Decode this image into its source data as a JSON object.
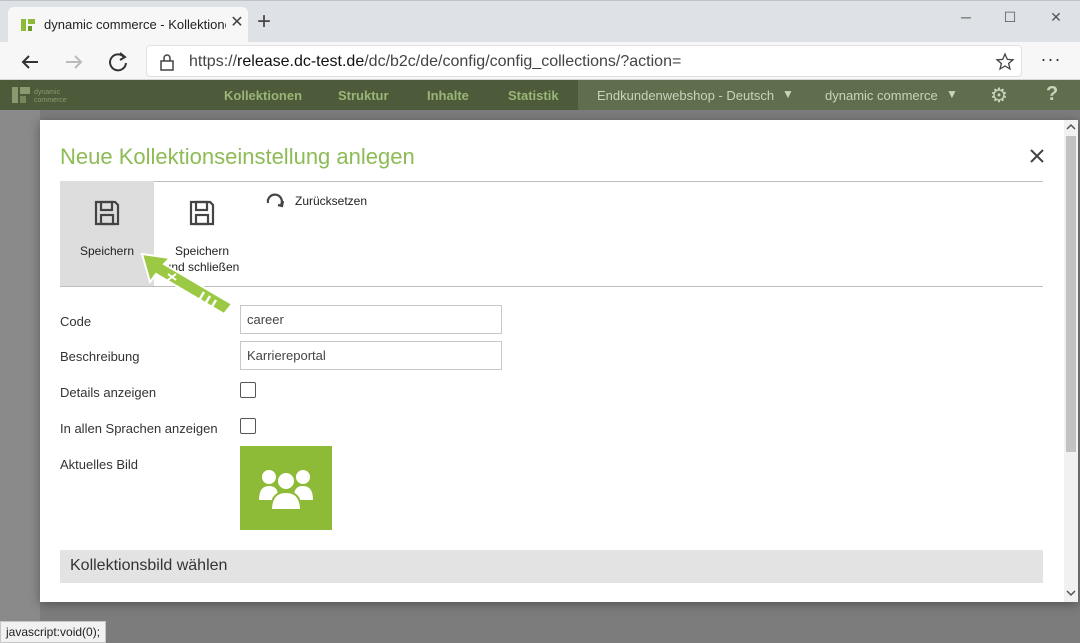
{
  "browser": {
    "tab_title": "dynamic commerce - Kollektione",
    "url_prefix": "https://",
    "url_host": "release.dc-test.de",
    "url_path": "/dc/b2c/de/config/config_collections/?action=",
    "status_text": "javascript:void(0);"
  },
  "app_header": {
    "nav": [
      "Kollektionen",
      "Struktur",
      "Inhalte",
      "Statistik"
    ],
    "shop_selector": "Endkundenwebshop - Deutsch",
    "company_selector": "dynamic commerce",
    "help_label": "?"
  },
  "modal": {
    "title": "Neue Kollektionseinstellung anlegen",
    "toolbar": {
      "save_label": "Speichern",
      "save_close_label": "Speichern und schließen",
      "reset_label": "Zurücksetzen"
    },
    "form": {
      "code_label": "Code",
      "code_value": "career",
      "description_label": "Beschreibung",
      "description_value": "Karriereportal",
      "details_label": "Details anzeigen",
      "details_checked": false,
      "all_languages_label": "In allen Sprachen anzeigen",
      "all_languages_checked": false,
      "image_label": "Aktuelles Bild",
      "image_icon": "users-group-icon"
    },
    "section_title": "Kollektionsbild wählen"
  },
  "colors": {
    "accent_green": "#8dbb55",
    "image_tile_green": "#8dbb37",
    "arrow_green": "#9bc944",
    "header_dark": "#4d5b3a"
  }
}
